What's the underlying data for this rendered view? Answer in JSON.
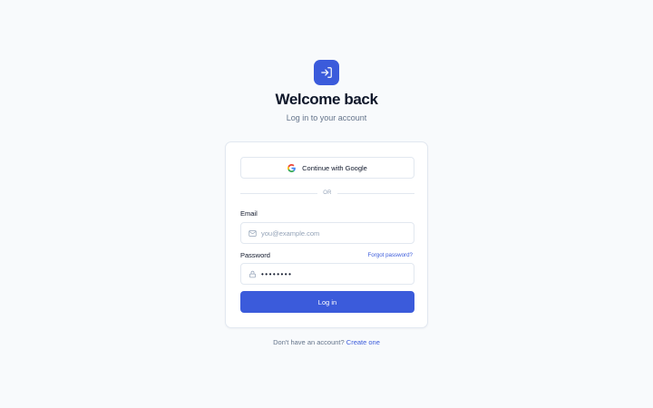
{
  "header": {
    "title": "Welcome back",
    "subtitle": "Log in to your account",
    "icon": "login-arrow-icon"
  },
  "auth": {
    "google_label": "Continue with Google",
    "divider_text": "OR",
    "email_label": "Email",
    "email_placeholder": "you@example.com",
    "email_value": "",
    "password_label": "Password",
    "password_value": "********",
    "forgot_label": "Forgot password?",
    "submit_label": "Log in"
  },
  "footer": {
    "prompt": "Don't have an account?",
    "link_label": "Create one"
  },
  "colors": {
    "accent": "#3b5bdb",
    "background": "#f8fafc",
    "text": "#0f172a",
    "muted": "#64748b"
  }
}
